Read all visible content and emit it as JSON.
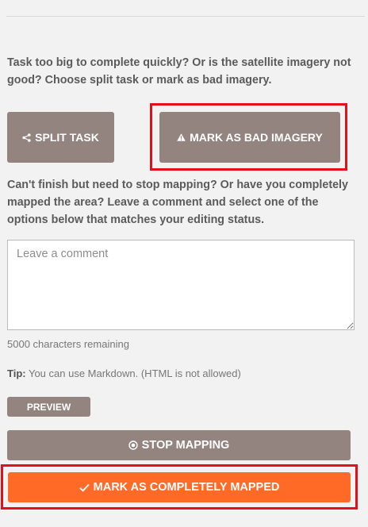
{
  "prompts": {
    "split_or_bad": "Task too big to complete quickly? Or is the satellite imagery not good? Choose split task or mark as bad imagery.",
    "stop_or_done": "Can't finish but need to stop mapping? Or have you completely mapped the area? Leave a comment and select one of the options below that matches your editing status."
  },
  "buttons": {
    "split": "SPLIT TASK",
    "bad_imagery": "MARK AS BAD IMAGERY",
    "preview": "PREVIEW",
    "stop": "STOP MAPPING",
    "complete": "MARK AS COMPLETELY MAPPED"
  },
  "comment": {
    "placeholder": "Leave a comment",
    "value": "",
    "chars_remaining": "5000 characters remaining"
  },
  "tip": {
    "label": "Tip:",
    "text": " You can use Markdown. (HTML is not allowed)"
  },
  "icons": {
    "split": "share-split-icon",
    "bad_imagery": "warning-icon",
    "stop": "stop-circle-icon",
    "complete": "check-icon"
  },
  "colors": {
    "button": "#93847f",
    "primary": "#ff6a26",
    "highlight": "#e3101a",
    "background": "#f2f2f2"
  }
}
